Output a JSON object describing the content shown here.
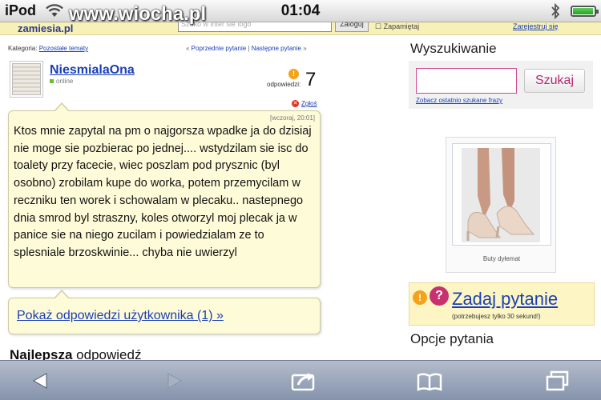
{
  "status_bar": {
    "carrier": "iPod",
    "time": "01:04"
  },
  "watermark": "www.wiocha.pl",
  "site_header": {
    "logo": "zamiesia.pl",
    "search_placeholder": "Szuko w inter sie logo",
    "search_button": "Zaloguj",
    "checkbox_label": "Zapamiętaj",
    "link": "Zarejestruj się"
  },
  "question": {
    "category_label": "Kategoria:",
    "category_link": "Pozostałe tematy",
    "prev": "Poprzednie pytanie",
    "next": "Następne pytanie",
    "username": "NiesmialaOna",
    "status": "online",
    "answers_label": "odpowiedzi:",
    "answers_count": "7",
    "report_label": "Zgłoś",
    "timestamp": "[wczoraj, 20:01]",
    "text": "Ktos mnie zapytal na pm o najgorsza wpadke ja do dzisiaj nie moge sie pozbierac po jednej.... wstydzilam sie isc do toalety przy facecie, wiec poszlam pod prysznic (byl osobno) zrobilam kupe do worka, potem przemycilam w reczniku ten worek i schowalam w plecaku.. nastepnego dnia smrod byl straszny, koles otworzyl moj plecak ja w panice sie na niego zucilam i powiedzialam ze to splesniale brzoskwinie... chyba nie uwierzyl",
    "show_answers_link": "Pokaż odpowiedzi użytkownika (1) »",
    "best_answer_bold": "Najlepsza",
    "best_answer_rest": " odpowiedź"
  },
  "sidebar": {
    "search_title": "Wyszukiwanie",
    "search_value": "",
    "search_button": "Szukaj",
    "recent_link": "Zobacz ostatnio szukane frazy",
    "product_caption": "Buty dyłemat",
    "ask_link": "Zadaj pytanie",
    "ask_note": "(potrzebujesz tylko 30 sekund!)",
    "options_title": "Opcje pytania"
  },
  "battery_level_percent": 95,
  "colors": {
    "link": "#1a3fb5",
    "bubble": "#fefbd8",
    "accent": "#c8306f"
  }
}
